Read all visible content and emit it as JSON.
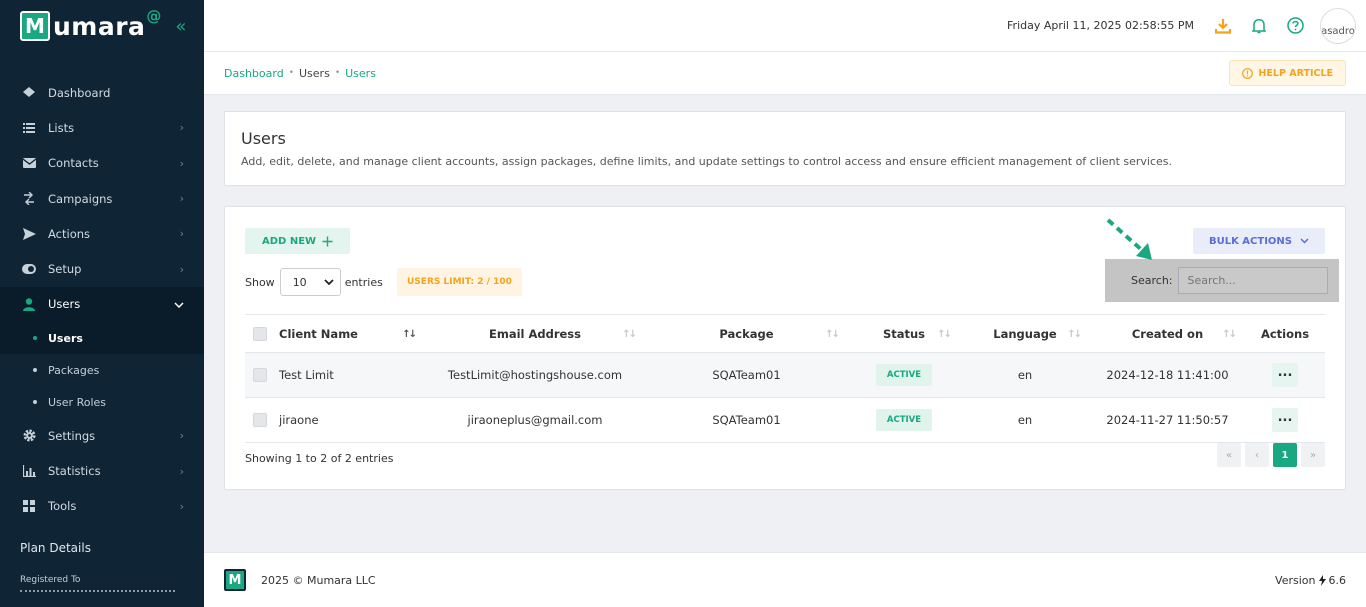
{
  "brand": {
    "logo_letter": "M",
    "name": "umara",
    "at": "@"
  },
  "sidebar": {
    "items": [
      {
        "label": "Dashboard"
      },
      {
        "label": "Lists"
      },
      {
        "label": "Contacts"
      },
      {
        "label": "Campaigns"
      },
      {
        "label": "Actions"
      },
      {
        "label": "Setup"
      },
      {
        "label": "Users"
      },
      {
        "label": "Settings"
      },
      {
        "label": "Statistics"
      },
      {
        "label": "Tools"
      }
    ],
    "sub_items": [
      {
        "label": "Users"
      },
      {
        "label": "Packages"
      },
      {
        "label": "User Roles"
      }
    ],
    "plan_details": "Plan Details",
    "registered_to": "Registered To"
  },
  "header": {
    "datetime": "Friday April 11, 2025 02:58:55 PM",
    "avatar_alt": "asadro"
  },
  "breadcrumb": [
    "Dashboard",
    "Users",
    "Users"
  ],
  "help_article": "HELP ARTICLE",
  "page": {
    "title": "Users",
    "description": "Add, edit, delete, and manage client accounts, assign packages, define limits, and update settings to control access and ensure efficient management of client services."
  },
  "toolbar": {
    "add_new": "ADD NEW",
    "bulk_actions": "BULK ACTIONS",
    "show_label": "Show",
    "entries_value": "10",
    "entries_label": "entries",
    "users_limit": "USERS LIMIT: 2 / 100",
    "search_label": "Search:",
    "search_placeholder": "Search..."
  },
  "table": {
    "headers": [
      "Client Name",
      "Email Address",
      "Package",
      "Status",
      "Language",
      "Created on",
      "Actions"
    ],
    "rows": [
      {
        "name": "Test Limit",
        "email": "TestLimit@hostingshouse.com",
        "package": "SQATeam01",
        "status": "ACTIVE",
        "language": "en",
        "created": "2024-12-18 11:41:00"
      },
      {
        "name": "jiraone",
        "email": "jiraoneplus@gmail.com",
        "package": "SQATeam01",
        "status": "ACTIVE",
        "language": "en",
        "created": "2024-11-27 11:50:57"
      }
    ],
    "showing": "Showing 1 to 2 of 2 entries",
    "current_page": "1"
  },
  "footer": {
    "copyright": "2025 © Mumara LLC",
    "version_label": "Version",
    "version": "6.6"
  },
  "colors": {
    "accent": "#19a881",
    "sidebar_bg": "#0f2536",
    "warning": "#f2a51a",
    "bulk": "#5a6dd8"
  }
}
